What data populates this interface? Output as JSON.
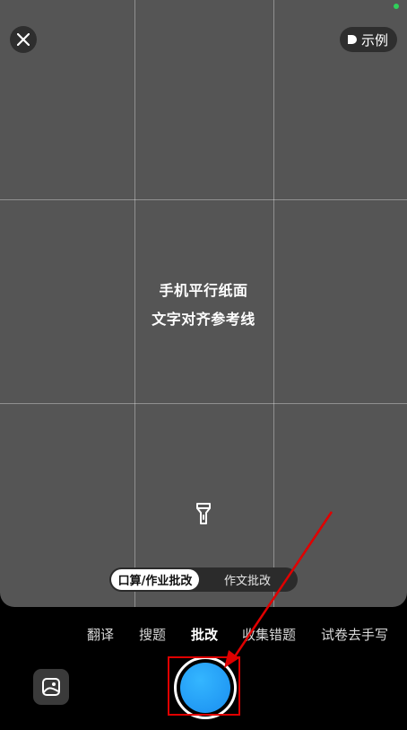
{
  "viewfinder": {
    "hint_line1": "手机平行纸面",
    "hint_line2": "文字对齐参考线"
  },
  "header": {
    "close_icon": "close-icon",
    "example_label": "示例",
    "example_icon": "play-icon"
  },
  "mode_switch": {
    "options": [
      {
        "label": "口算/作业批改",
        "selected": true
      },
      {
        "label": "作文批改",
        "selected": false
      }
    ]
  },
  "tabs": [
    {
      "label": "翻译",
      "active": false
    },
    {
      "label": "搜题",
      "active": false
    },
    {
      "label": "批改",
      "active": true
    },
    {
      "label": "收集错题",
      "active": false
    },
    {
      "label": "试卷去手写",
      "active": false
    }
  ],
  "controls": {
    "gallery_icon": "gallery-icon",
    "shutter_icon": "shutter-button",
    "flashlight_icon": "flashlight-icon"
  },
  "annotation": {
    "color": "#e00000"
  },
  "colors": {
    "shutter": "#1a8ef0",
    "viewfinder_bg": "#555555",
    "status_dot": "#2fd15a"
  }
}
